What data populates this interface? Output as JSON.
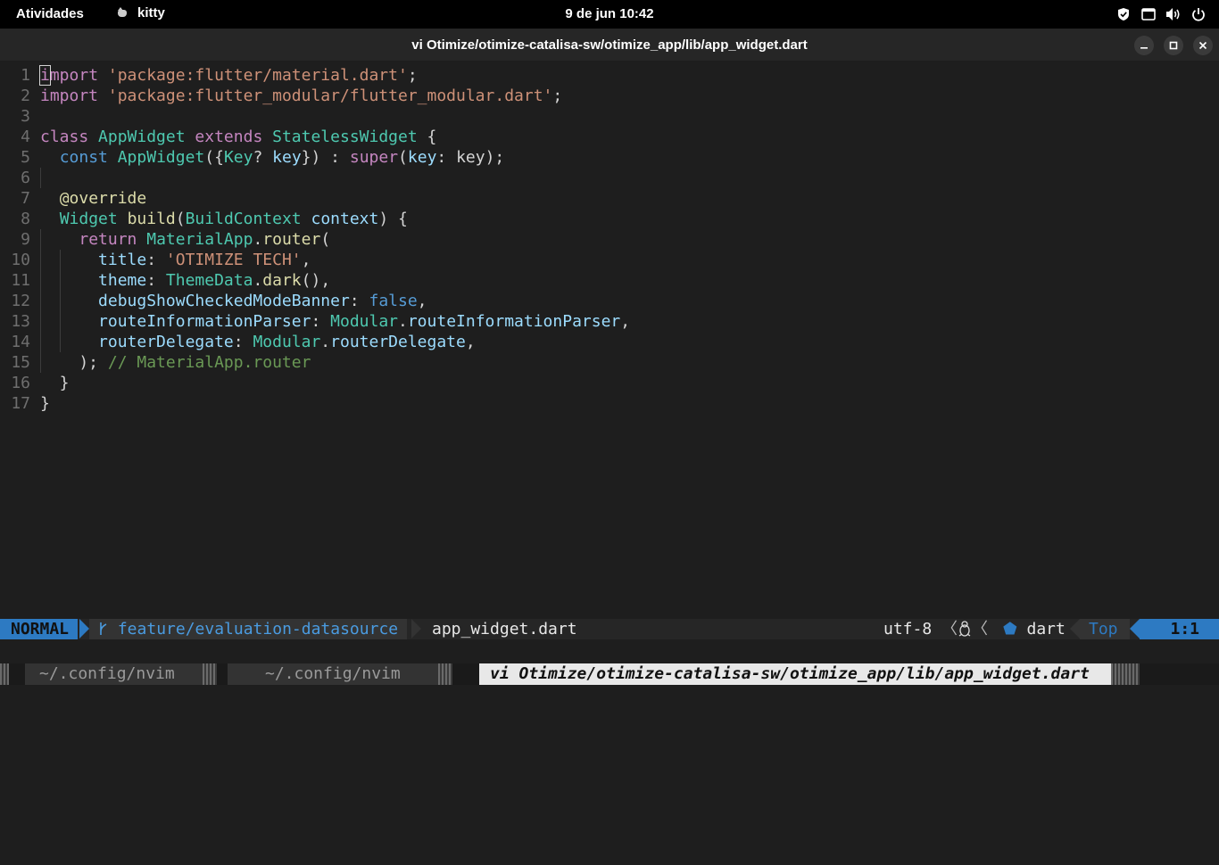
{
  "topbar": {
    "activities": "Atividades",
    "app_name": "kitty",
    "clock": "9 de jun  10:42",
    "tray_icons": [
      "shield-icon",
      "screen-icon",
      "volume-icon",
      "power-icon"
    ]
  },
  "window": {
    "title": "vi Otimize/otimize-catalisa-sw/otimize_app/lib/app_widget.dart"
  },
  "editor": {
    "line_numbers": [
      "1",
      "2",
      "3",
      "4",
      "5",
      "6",
      "7",
      "8",
      "9",
      "10",
      "11",
      "12",
      "13",
      "14",
      "15",
      "16",
      "17"
    ],
    "lines": [
      "import 'package:flutter/material.dart';",
      "import 'package:flutter_modular/flutter_modular.dart';",
      "",
      "class AppWidget extends StatelessWidget {",
      "  const AppWidget({Key? key}) : super(key: key);",
      "",
      "  @override",
      "  Widget build(BuildContext context) {",
      "    return MaterialApp.router(",
      "      title: 'OTIMIZE TECH',",
      "      theme: ThemeData.dark(),",
      "      debugShowCheckedModeBanner: false,",
      "      routeInformationParser: Modular.routeInformationParser,",
      "      routerDelegate: Modular.routerDelegate,",
      "    ); // MaterialApp.router",
      "  }",
      "}"
    ]
  },
  "statusline": {
    "mode": "NORMAL",
    "branch_icon": "git-branch-icon",
    "branch": "feature/evaluation-datasource",
    "filename": "app_widget.dart",
    "encoding": "utf-8",
    "os_icon": "linux-icon",
    "filetype": "dart",
    "position": "Top",
    "location": "1:1",
    "accent": "#2d7ac2"
  },
  "tabs": [
    {
      "label": "~/.config/nvim",
      "active": false
    },
    {
      "label": "~/.config/nvim",
      "active": false
    },
    {
      "label": "vi Otimize/otimize-catalisa-sw/otimize_app/lib/app_widget.dart",
      "active": true
    }
  ]
}
